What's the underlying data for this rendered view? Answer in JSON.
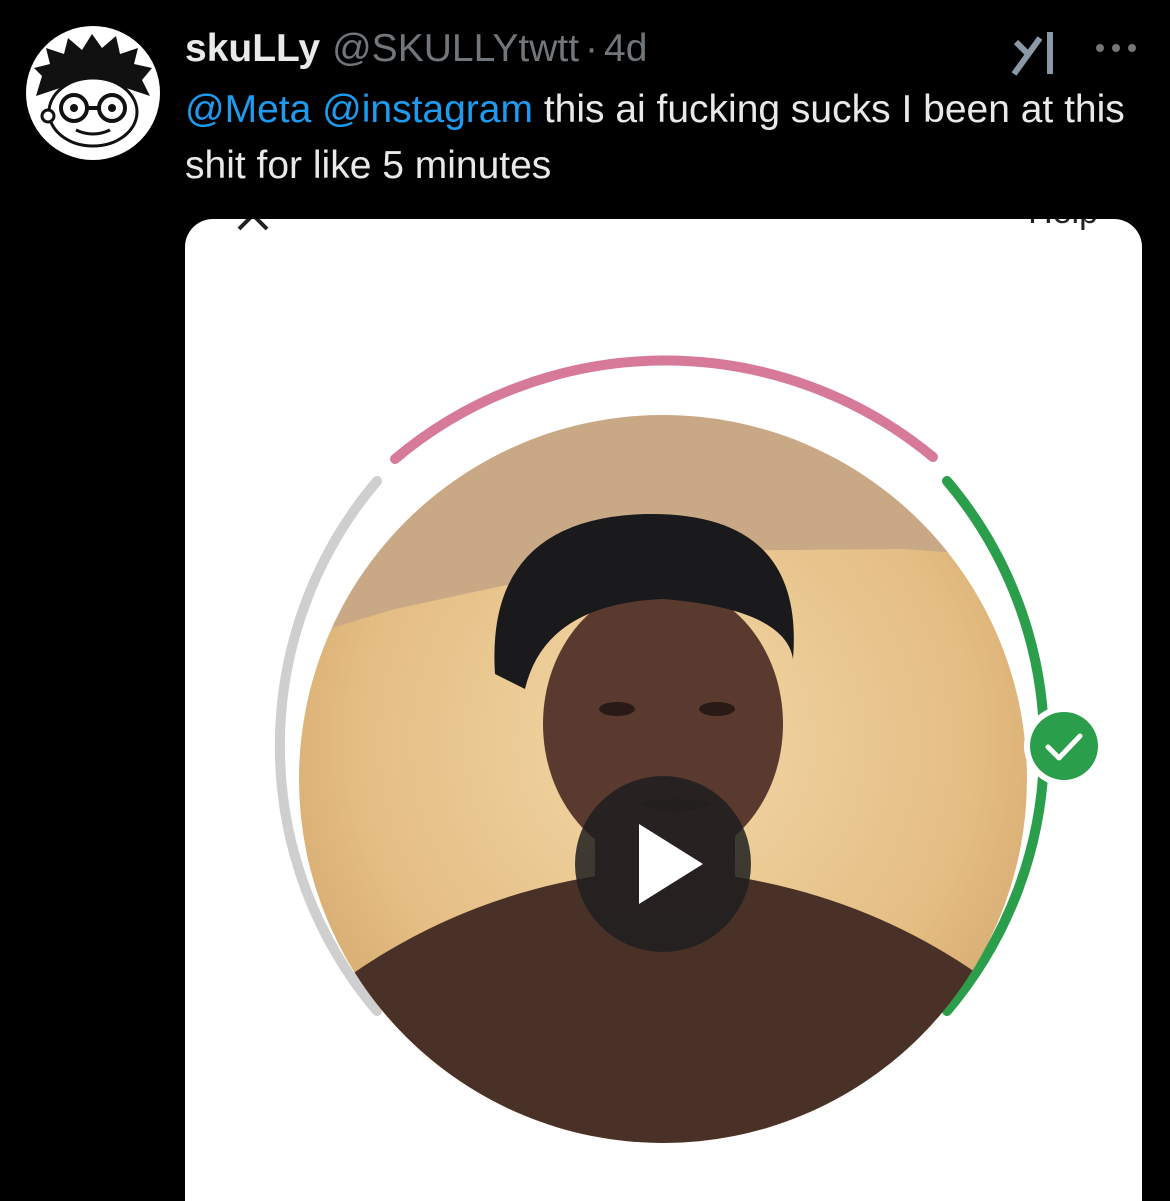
{
  "tweet": {
    "display_name": "skuLLy",
    "handle": "@SKULLYtwtt",
    "separator": "·",
    "time": "4d",
    "mentions": [
      "@Meta",
      "@instagram"
    ],
    "text": "this ai fucking sucks I been at this shit for like 5 minutes"
  },
  "media": {
    "close_label": "×",
    "help_label": "Help",
    "icons": {
      "play": "play-icon",
      "check": "check-icon",
      "grok": "grok-icon",
      "more": "more-icon"
    },
    "colors": {
      "arc_top": "#d77a99",
      "arc_right": "#2a9e4a",
      "arc_left": "#cfcfcf",
      "check_fill": "#2a9e4a"
    }
  }
}
